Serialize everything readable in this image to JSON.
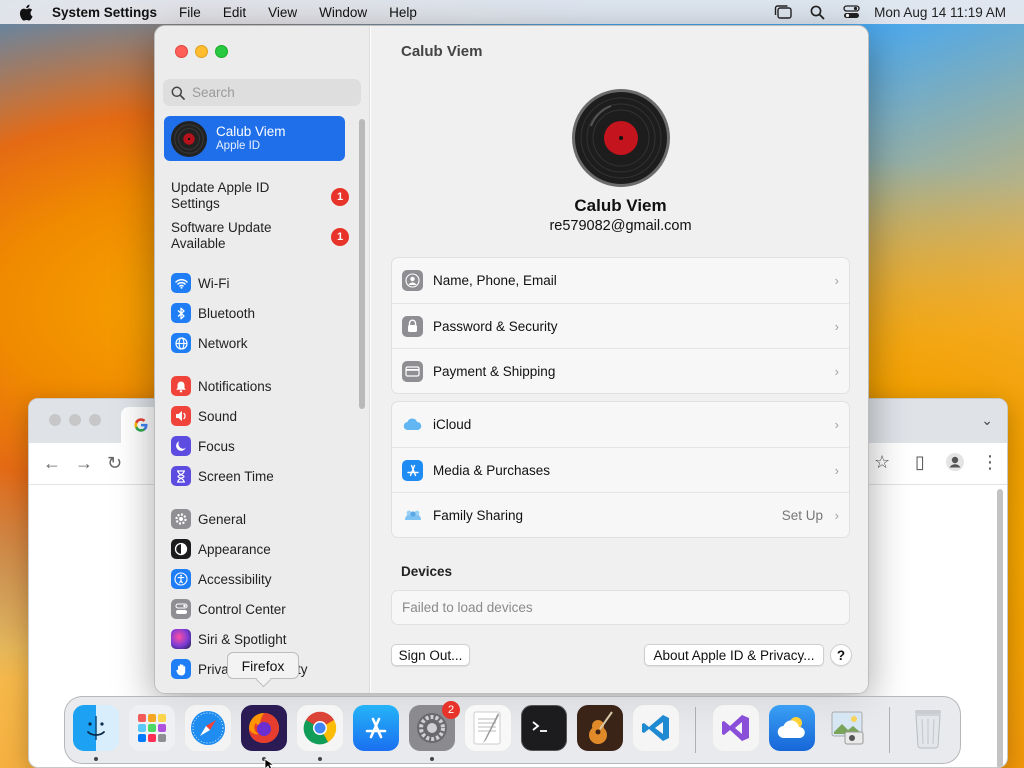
{
  "menubar": {
    "app_name": "System Settings",
    "menus": [
      "File",
      "Edit",
      "View",
      "Window",
      "Help"
    ],
    "clock": "Mon Aug 14  11:19 AM"
  },
  "settings": {
    "search_placeholder": "Search",
    "account": {
      "name": "Calub Viem",
      "subtitle": "Apple ID"
    },
    "alerts": [
      {
        "label_line1": "Update Apple ID",
        "label_line2": "Settings",
        "badge": "1"
      },
      {
        "label_line1": "Software Update",
        "label_line2": "Available",
        "badge": "1"
      }
    ],
    "sidebar_items": [
      {
        "label": "Wi-Fi",
        "icon": "wifi-icon",
        "color": "#1f7ef5"
      },
      {
        "label": "Bluetooth",
        "icon": "bluetooth-icon",
        "color": "#1f7ef5"
      },
      {
        "label": "Network",
        "icon": "globe-icon",
        "color": "#1f7ef5"
      },
      {
        "label": "Notifications",
        "icon": "bell-icon",
        "color": "#f0443a"
      },
      {
        "label": "Sound",
        "icon": "speaker-icon",
        "color": "#f0443a"
      },
      {
        "label": "Focus",
        "icon": "moon-icon",
        "color": "#5d4ce0"
      },
      {
        "label": "Screen Time",
        "icon": "hourglass-icon",
        "color": "#5d4ce0"
      },
      {
        "label": "General",
        "icon": "gear-icon",
        "color": "#8e8e93"
      },
      {
        "label": "Appearance",
        "icon": "appearance-icon",
        "color": "#1c1c1e"
      },
      {
        "label": "Accessibility",
        "icon": "accessibility-icon",
        "color": "#1f7ef5"
      },
      {
        "label": "Control Center",
        "icon": "control-center-icon",
        "color": "#8e8e93"
      },
      {
        "label": "Siri & Spotlight",
        "icon": "siri-icon",
        "color": "#7a3bd6"
      },
      {
        "label": "Privacy & Security",
        "icon": "hand-icon",
        "color": "#1f7ef5"
      }
    ],
    "content": {
      "title": "Calub Viem",
      "user_name": "Calub Viem",
      "user_email": "re579082@gmail.com",
      "group1": [
        {
          "label": "Name, Phone, Email",
          "icon": "contact-icon"
        },
        {
          "label": "Password & Security",
          "icon": "lock-icon"
        },
        {
          "label": "Payment & Shipping",
          "icon": "card-icon"
        }
      ],
      "group2": [
        {
          "label": "iCloud",
          "icon": "cloud-icon",
          "extra": ""
        },
        {
          "label": "Media & Purchases",
          "icon": "app-store-icon",
          "extra": ""
        },
        {
          "label": "Family Sharing",
          "icon": "family-icon",
          "extra": "Set Up"
        }
      ],
      "devices_label": "Devices",
      "devices_status": "Failed to load devices",
      "sign_out": "Sign Out...",
      "about": "About Apple ID & Privacy...",
      "help": "?"
    }
  },
  "tooltip": "Firefox",
  "dock": {
    "items": [
      "Finder",
      "Launchpad",
      "Safari",
      "Firefox",
      "Chrome",
      "App Store",
      "System Settings",
      "TextEdit",
      "Terminal",
      "GarageBand",
      "Visual Studio Code",
      "Visual Studio",
      "Weather",
      "Preview",
      "Trash"
    ],
    "settings_badge": "2"
  }
}
